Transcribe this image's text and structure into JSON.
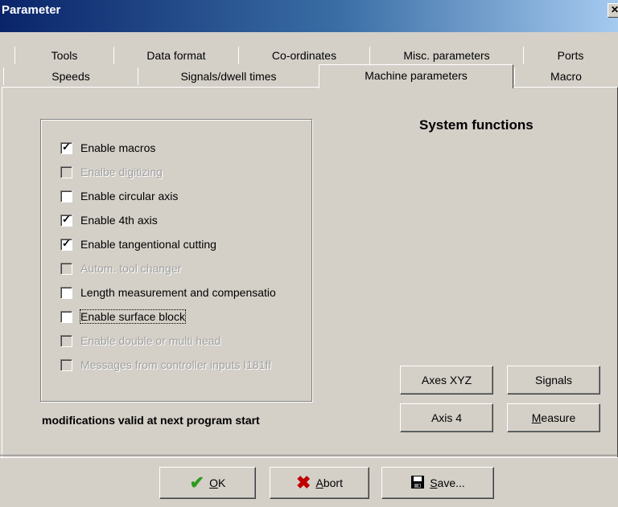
{
  "window": {
    "title": "Parameter",
    "close_glyph": "✕"
  },
  "tabs": {
    "row1": [
      "Tools",
      "Data format",
      "Co-ordinates",
      "Misc. parameters",
      "Ports"
    ],
    "row2": [
      "Speeds",
      "Signals/dwell times",
      "Machine parameters",
      "Macro"
    ],
    "active": "Machine parameters"
  },
  "checkboxes": [
    {
      "label": "Enable macros",
      "checked": true,
      "enabled": true
    },
    {
      "label": "Enalbe digitizing",
      "checked": false,
      "enabled": false
    },
    {
      "label": "Enable circular axis",
      "checked": false,
      "enabled": true
    },
    {
      "label": "Enable 4th axis",
      "checked": true,
      "enabled": true
    },
    {
      "label": "Enable tangentional cutting",
      "checked": true,
      "enabled": true
    },
    {
      "label": "Autom. tool changer",
      "checked": false,
      "enabled": false
    },
    {
      "label": "Length measurement and compensatio",
      "checked": false,
      "enabled": true
    },
    {
      "label": "Enable surface block",
      "checked": false,
      "enabled": true,
      "focused": true
    },
    {
      "label": "Enable double or multi head",
      "checked": false,
      "enabled": false
    },
    {
      "label": "Messages from controller inputs I181ff",
      "checked": false,
      "enabled": false
    }
  ],
  "system_functions": {
    "heading": "System functions",
    "buttons": {
      "axes_xyz": "Axes XYZ",
      "signals": "Signals",
      "axis4": "Axis 4",
      "measure": "Measure"
    }
  },
  "note": "modifications valid at next program start",
  "footer": {
    "ok": "OK",
    "abort": "Abort",
    "save": "Save..."
  },
  "colors": {
    "ok_icon": "#2e9a1e",
    "abort_icon": "#c00000"
  }
}
